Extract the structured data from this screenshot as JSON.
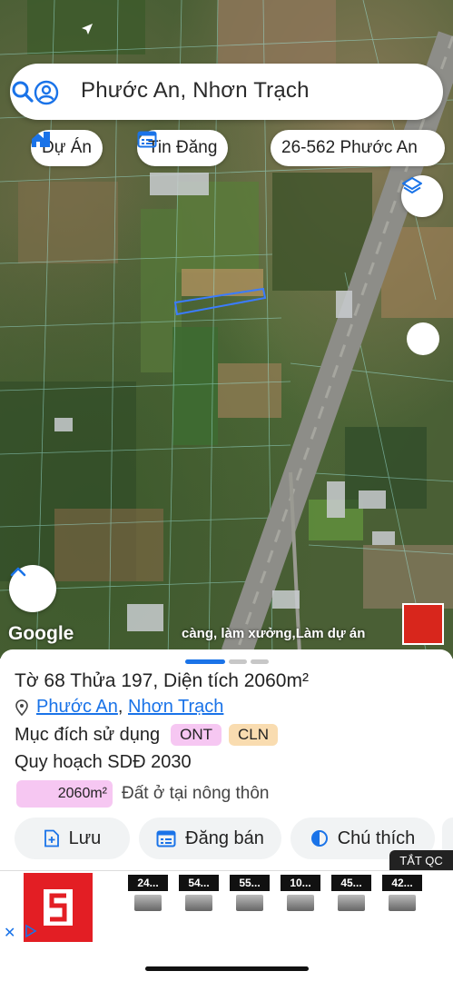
{
  "search": {
    "query": "Phước An, Nhơn Trạch"
  },
  "chips": [
    {
      "label": "Dự Án",
      "icon": "home-building-icon"
    },
    {
      "label": "Tin Đăng",
      "icon": "calendar-list-icon"
    },
    {
      "label": "26-562 Phước An"
    }
  ],
  "map": {
    "attribution": "Google",
    "overlay_text": "càng, làm xưởng,Làm dự án"
  },
  "parcel": {
    "title": "Tờ 68 Thửa 197, Diện tích 2060m²",
    "location_ward": "Phước An",
    "location_separator": ", ",
    "location_district": "Nhơn Trạch",
    "purpose_label": "Mục đích sử dụng",
    "tags": [
      {
        "code": "ONT",
        "color": "#f6c7f2"
      },
      {
        "code": "CLN",
        "color": "#f9dcb0"
      }
    ],
    "plan_label": "Quy hoạch SDĐ 2030",
    "area_value": "2060m²",
    "area_desc": "Đất ở tại nông thôn"
  },
  "actions": [
    {
      "label": "Lưu",
      "icon": "add-file-icon"
    },
    {
      "label": "Đăng bán",
      "icon": "calendar-list-icon"
    },
    {
      "label": "Chú thích",
      "icon": "half-circle-icon"
    }
  ],
  "ad": {
    "close_label": "TẮT QC",
    "prices": [
      "24...",
      "54...",
      "55...",
      "10...",
      "45...",
      "42..."
    ]
  },
  "colors": {
    "accent": "#1a73e8",
    "parcel_outline": "#3b7cff"
  }
}
